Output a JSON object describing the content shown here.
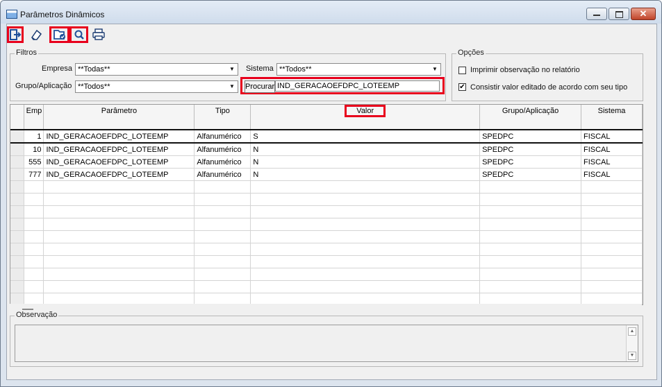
{
  "window": {
    "title": "Parâmetros Dinâmicos",
    "close_glyph": "✕"
  },
  "toolbar": {
    "buttons": [
      {
        "name": "exit-icon",
        "highlighted": true
      },
      {
        "name": "eraser-icon",
        "highlighted": false
      },
      {
        "name": "folder-check-icon",
        "highlighted": true
      },
      {
        "name": "search-icon",
        "highlighted": true
      },
      {
        "name": "printer-icon",
        "highlighted": false
      }
    ]
  },
  "filtros": {
    "legend": "Filtros",
    "empresa_label": "Empresa",
    "empresa_value": "**Todas**",
    "sistema_label": "Sistema",
    "sistema_value": "**Todos**",
    "grupo_label": "Grupo/Aplicação",
    "grupo_value": "**Todos**",
    "procurar_label": "Procurar",
    "procurar_value": "IND_GERACAOEFDPC_LOTEEMP"
  },
  "opcoes": {
    "legend": "Opções",
    "imprimir_label": "Imprimir observação no relatório",
    "imprimir_checked": false,
    "consistir_label": "Consistir valor editado de acordo com seu tipo",
    "consistir_checked": true,
    "check_mark": "✔"
  },
  "grid": {
    "headers": [
      "Emp",
      "Parâmetro",
      "Tipo",
      "Valor",
      "Grupo/Aplicação",
      "Sistema"
    ],
    "rows": [
      {
        "emp": "1",
        "parametro": "IND_GERACAOEFDPC_LOTEEMP",
        "tipo": "Alfanumérico",
        "valor": "S",
        "grupo": "SPEDPC",
        "sistema": "FISCAL"
      },
      {
        "emp": "10",
        "parametro": "IND_GERACAOEFDPC_LOTEEMP",
        "tipo": "Alfanumérico",
        "valor": "N",
        "grupo": "SPEDPC",
        "sistema": "FISCAL"
      },
      {
        "emp": "555",
        "parametro": "IND_GERACAOEFDPC_LOTEEMP",
        "tipo": "Alfanumérico",
        "valor": "N",
        "grupo": "SPEDPC",
        "sistema": "FISCAL"
      },
      {
        "emp": "777",
        "parametro": "IND_GERACAOEFDPC_LOTEEMP",
        "tipo": "Alfanumérico",
        "valor": "N",
        "grupo": "SPEDPC",
        "sistema": "FISCAL"
      }
    ]
  },
  "observacao": {
    "legend": "Observação",
    "value": ""
  },
  "colors": {
    "highlight": "#e8001c",
    "window_bg": "#dce4ee",
    "client_bg": "#f0f0f0"
  }
}
